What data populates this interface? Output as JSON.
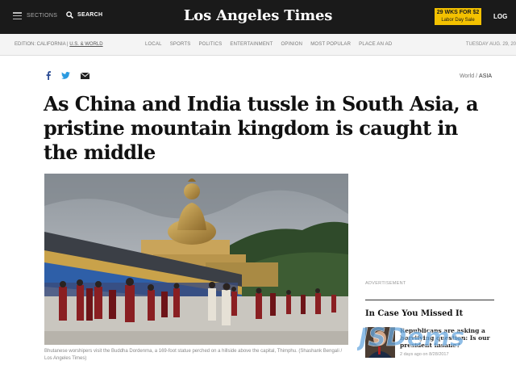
{
  "header": {
    "sections_label": "SECTIONS",
    "search_label": "SEARCH",
    "logo": "Los Angeles Times",
    "promo_main": "29 WKS FOR $2",
    "promo_sub": "Labor Day Sale",
    "login_label": "LOG"
  },
  "navbar": {
    "edition_prefix": "EDITION: CALIFORNIA | ",
    "edition_link": "U.S. & WORLD",
    "items": [
      "LOCAL",
      "SPORTS",
      "POLITICS",
      "ENTERTAINMENT",
      "OPINION",
      "MOST POPULAR",
      "PLACE AN AD"
    ],
    "date": "TUESDAY AUG. 29, 20"
  },
  "social": {
    "icons": [
      "facebook-icon",
      "twitter-icon",
      "email-icon"
    ]
  },
  "breadcrumb": {
    "section": "World",
    "separator": "/",
    "subsection": "ASIA"
  },
  "article": {
    "headline": "As China and India tussle in South Asia, a pristine mountain kingdom is caught in the middle",
    "caption": "Bhutanese worshipers visit the Buddha Dordenma, a 169-foot statue perched on a hillside above the capital, Thimphu. (Shashank Bengali / Los Angeles Times)"
  },
  "rail": {
    "ad_label": "ADVERTISEMENT",
    "icymi_title": "In Case You Missed It",
    "story_title": "Republicans are asking a horrifying question: Is our president insane?",
    "story_meta": "2 days ago on 8/28/2017"
  },
  "watermark": {
    "text": "JSDems"
  },
  "colors": {
    "topbar": "#1a1a1a",
    "promo": "#f3c100",
    "navbar": "#f4f4f4",
    "watermark": "#6aa9e0"
  }
}
